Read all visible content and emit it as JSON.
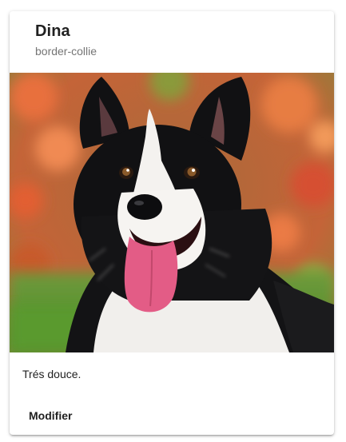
{
  "card": {
    "title": "Dina",
    "subtitle": "border-collie",
    "image_alt": "border-collie photo",
    "description": "Trés douce.",
    "actions": {
      "edit_label": "Modifier"
    }
  }
}
